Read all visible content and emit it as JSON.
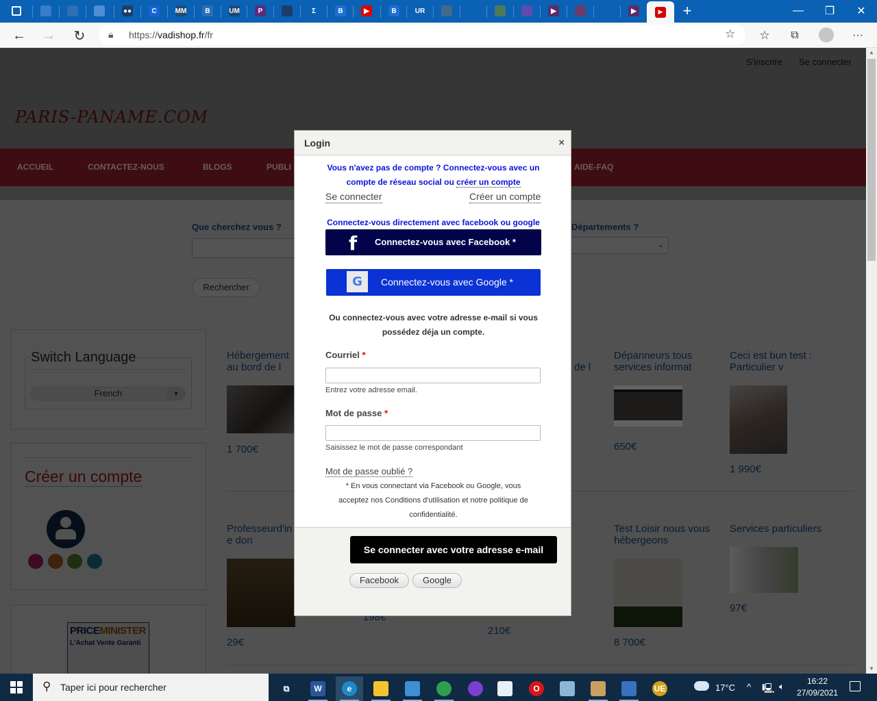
{
  "browser": {
    "tabs": [
      {
        "icon": "window-icon",
        "label": "",
        "color": "#0b61b3"
      },
      {
        "icon": "pen-icon",
        "label": "",
        "color": "#3a7cc9"
      },
      {
        "icon": "ship-icon",
        "label": "",
        "color": "#2e6fb5"
      },
      {
        "icon": "grid-icon",
        "label": "",
        "color": "#4f8ed1"
      },
      {
        "icon": "medium-icon",
        "label": "●●",
        "color": "#1b3d69"
      },
      {
        "icon": "c-icon",
        "label": "C",
        "color": "#1565d8"
      },
      {
        "icon": "mm-icon",
        "label": "MM",
        "color": "#234a74"
      },
      {
        "icon": "b-arrow-icon",
        "label": "B",
        "color": "#2e6fb5"
      },
      {
        "icon": "um-icon",
        "label": "UM",
        "color": "#1c4877"
      },
      {
        "icon": "p-icon",
        "label": "P",
        "color": "#5a2c7a"
      },
      {
        "icon": "bolt-icon",
        "label": "",
        "color": "#1b3d69"
      },
      {
        "icon": "sigma-icon",
        "label": "Σ",
        "color": "#0b61b3"
      },
      {
        "icon": "b-icon",
        "label": "B",
        "color": "#1f6fd1"
      },
      {
        "icon": "youtube-icon",
        "label": "▶",
        "color": "#e00000"
      },
      {
        "icon": "b-icon",
        "label": "B",
        "color": "#1f6fd1"
      },
      {
        "icon": "ur-icon",
        "label": "UR",
        "color": "#0b61b3"
      },
      {
        "icon": "bird-icon",
        "label": "",
        "color": "#406c8c"
      },
      {
        "icon": "blank-icon",
        "label": "",
        "color": "#0b61b3"
      },
      {
        "icon": "globe-icon",
        "label": "",
        "color": "#4f7a5a"
      },
      {
        "icon": "puzzle-icon",
        "label": "",
        "color": "#5d4bb0"
      },
      {
        "icon": "play-icon",
        "label": "▶",
        "color": "#5a2c6a"
      },
      {
        "icon": "square-icon",
        "label": "",
        "color": "#6a3c6a"
      },
      {
        "icon": "blank-icon",
        "label": "",
        "color": "#0b61b3"
      },
      {
        "icon": "play-icon",
        "label": "▶",
        "color": "#5a2c6a"
      }
    ],
    "active_tab_icon": "▶",
    "new_tab": "+",
    "window_controls": {
      "minimize": "—",
      "restore": "❐",
      "close": "✕"
    },
    "url_prefix": "https://",
    "url_domain": "vadishop.fr",
    "url_path": "/fr"
  },
  "site": {
    "logo": "PARIS-PANAME.COM",
    "top_links": [
      "S'inscrire",
      "Se connecter"
    ],
    "nav": [
      "ACCUEIL",
      "CONTACTEZ-NOUS",
      "BLOGS",
      "PUBLI",
      "AIDE-FAQ"
    ],
    "search": {
      "label": "Que cherchez vous ?",
      "departments_label": "Départements ?",
      "button": "Rechercher"
    },
    "sidebar": {
      "language_title": "Switch Language",
      "language_selected": "French",
      "create_account": "Créer un compte",
      "ad_brand_a": "PRICE",
      "ad_brand_b": "MINISTER",
      "ad_tagline": "L'Achat Vente Garanti"
    },
    "listings": [
      {
        "title": "Hébergement \nau bord de l",
        "price": "1 700€"
      },
      {
        "title": "de l",
        "price": ""
      },
      {
        "title": "Dépanneurs tous services informat",
        "price": "650€"
      },
      {
        "title": "Ceci est bun test : Particulier v",
        "price": "1 990€"
      },
      {
        "title": "Professeurd'in\ne don",
        "price": "29€"
      },
      {
        "title": "",
        "price": "198€"
      },
      {
        "title": "",
        "price": "210€"
      },
      {
        "title": "Test Loisir nous vous hébergeons",
        "price": "8 700€"
      },
      {
        "title": "Services particuliers",
        "price": "97€"
      }
    ]
  },
  "modal": {
    "title": "Login",
    "close": "×",
    "intro_line1": "Vous n'avez pas de compte ? Connectez-vous avec un",
    "intro_line2": "compte de réseau social ou ",
    "intro_link": "créer un compte",
    "tab_login": "Se connecter",
    "tab_register": "Créer un compte",
    "social_heading": "Connectez-vous directement avec facebook ou google",
    "facebook_button": "Connectez-vous avec Facebook *",
    "google_button": "Connectez-vous avec Google *",
    "email_intro_line1": "Ou connectez-vous avec votre adresse e-mail si vous",
    "email_intro_line2": "possédez déja un compte.",
    "email_label": "Courriel",
    "email_value": "",
    "email_help": "Entrez votre adresse email.",
    "password_label": "Mot de passe",
    "password_value": "",
    "password_help": "Saisissez le mot de passe correspondant",
    "required_mark": "*",
    "forgot": "Mot de passe oublié ?",
    "terms_line1": "* En vous connectant via Facebook ou Google, vous",
    "terms_line2": "acceptez nos Conditions d'utilisation et notre politique de",
    "terms_line3": "confidentialité.",
    "submit": "Se connecter avec votre adresse e-mail",
    "alt_facebook": "Facebook",
    "alt_google": "Google"
  },
  "taskbar": {
    "search_placeholder": "Taper ici pour rechercher",
    "apps": [
      {
        "icon": "task-view-icon",
        "glyph": "⧉",
        "color": "transparent"
      },
      {
        "icon": "word-icon",
        "glyph": "W",
        "color": "#2b579a"
      },
      {
        "icon": "edge-icon",
        "glyph": "e",
        "color": "#1e88c8"
      },
      {
        "icon": "file-explorer-icon",
        "glyph": "",
        "color": "#f4c430"
      },
      {
        "icon": "control-panel-icon",
        "glyph": "",
        "color": "#3d8fd6"
      },
      {
        "icon": "chrome-icon",
        "glyph": "",
        "color": "#2e9e4f"
      },
      {
        "icon": "vpn-icon",
        "glyph": "",
        "color": "#7a3fd0"
      },
      {
        "icon": "feather-icon",
        "glyph": "",
        "color": "#e8f0f6"
      },
      {
        "icon": "opera-icon",
        "glyph": "O",
        "color": "#d4161c"
      },
      {
        "icon": "notepad-icon",
        "glyph": "",
        "color": "#8db5d8"
      },
      {
        "icon": "paint-icon",
        "glyph": "",
        "color": "#c8a060"
      },
      {
        "icon": "remote-desktop-icon",
        "glyph": "",
        "color": "#3a70c0"
      },
      {
        "icon": "ultraedit-icon",
        "glyph": "UE",
        "color": "#d4a017"
      }
    ],
    "weather": "17°C",
    "time": "16:22",
    "date": "27/09/2021"
  }
}
